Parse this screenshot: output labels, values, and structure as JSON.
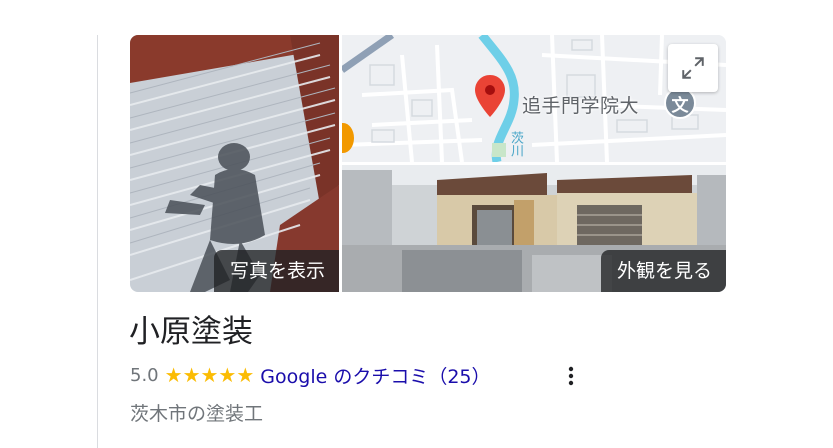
{
  "media": {
    "photos_button": "写真を表示",
    "exterior_button": "外観を見る",
    "map": {
      "place_label": "追手門学院大",
      "school_icon_glyph": "文",
      "river_label": "茨川"
    }
  },
  "business": {
    "name": "小原塗装",
    "rating": "5.0",
    "stars": "★★★★★",
    "reviews_link": "Google のクチコミ（25）",
    "category": "茨木市の塗装工"
  },
  "colors": {
    "link": "#1a0dab",
    "star": "#fbbc04",
    "pin": "#ea4335",
    "muted_text": "#70757a"
  },
  "icons": {
    "expand": "expand-icon",
    "more": "more-vert-icon",
    "pin": "map-pin-icon"
  }
}
